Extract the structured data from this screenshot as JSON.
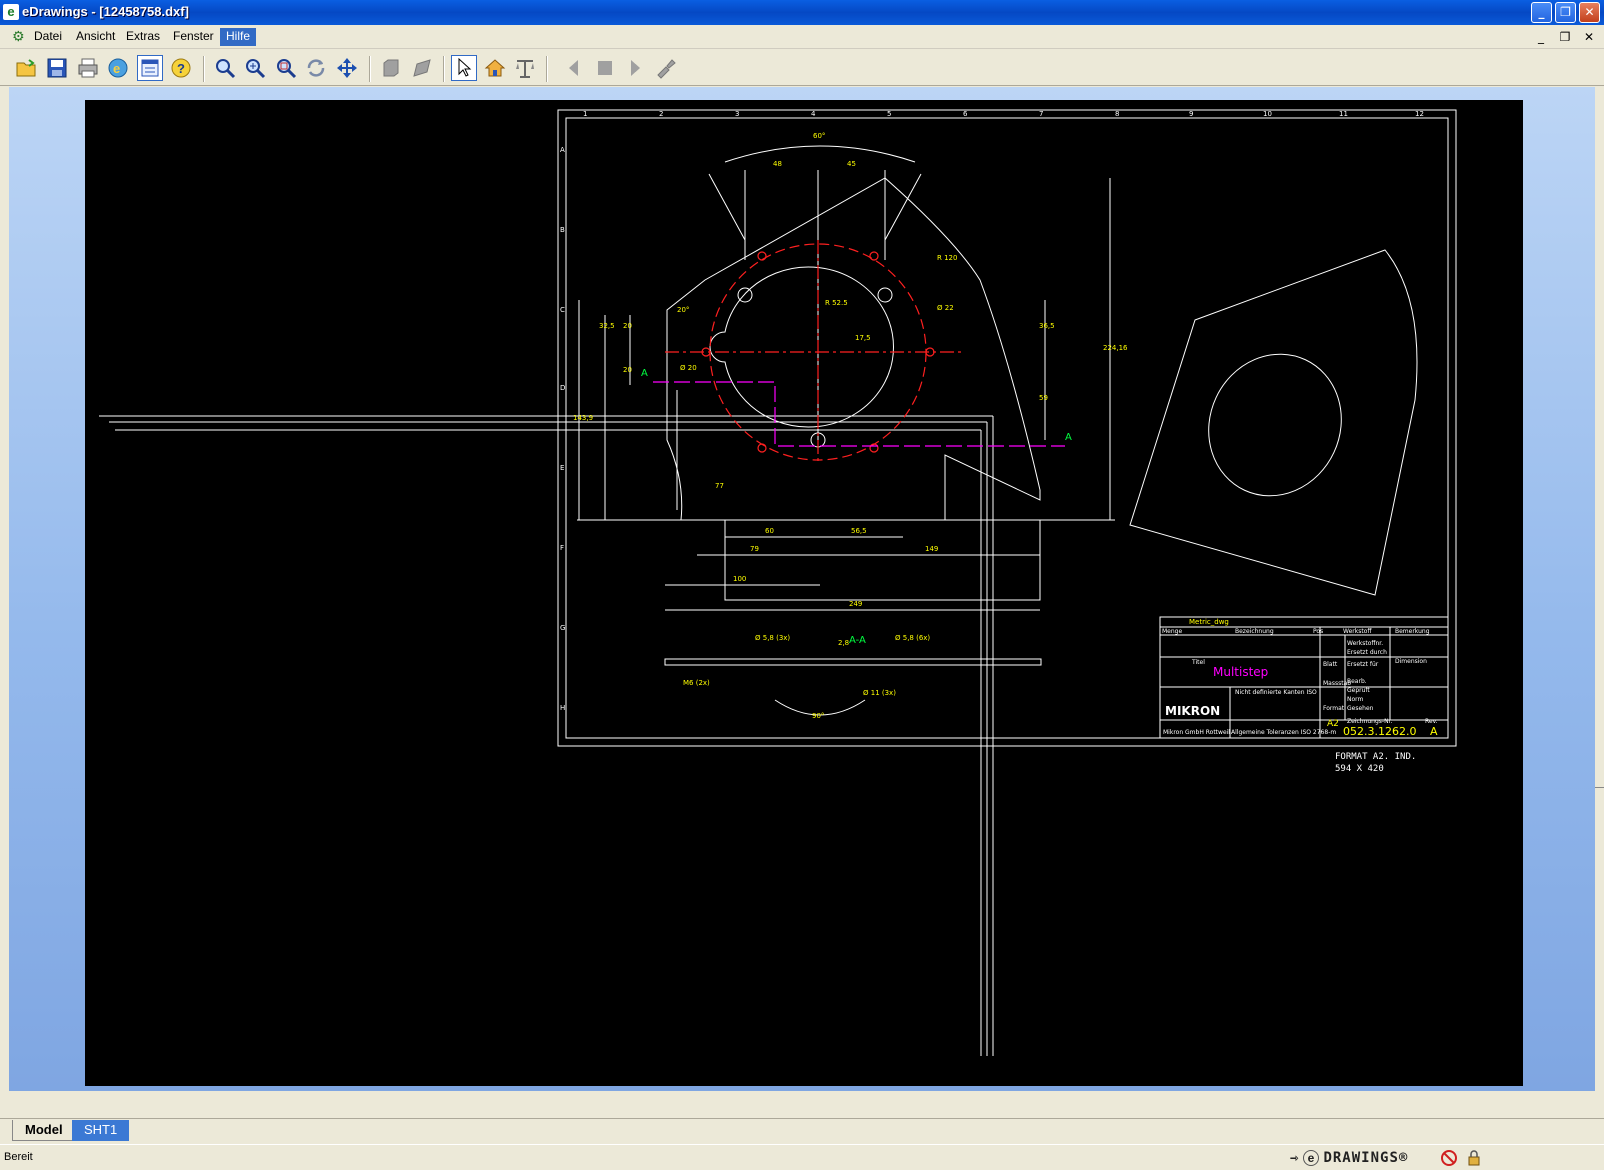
{
  "window": {
    "title": "eDrawings - [12458758.dxf]"
  },
  "menu": {
    "items": [
      "Datei",
      "Ansicht",
      "Extras",
      "Fenster",
      "Hilfe"
    ],
    "active": "Hilfe"
  },
  "toolbar": {
    "buttons": [
      "open-icon",
      "save-icon",
      "print-icon",
      "send-email-icon",
      "sheet-window-icon",
      "help-icon",
      "zoom-to-fit-icon",
      "zoom-in-out-icon",
      "zoom-to-area-icon",
      "rotate-icon",
      "pan-icon",
      "shaded-icon",
      "perspective-icon",
      "select-icon",
      "home-icon",
      "measure-icon",
      "previous-icon",
      "stop-icon",
      "play-icon",
      "markup-icon"
    ]
  },
  "drawing": {
    "frame_cols": [
      "1",
      "2",
      "3",
      "4",
      "5",
      "6",
      "7",
      "8",
      "9",
      "10",
      "11",
      "12"
    ],
    "frame_rows": [
      "A",
      "B",
      "C",
      "D",
      "E",
      "F",
      "G",
      "H"
    ],
    "dimensions": {
      "angle_top": "60°",
      "d48": "48",
      "d45": "45",
      "r120": "R 120",
      "r52": "R 52.5",
      "d22": "Ø 22",
      "d20a": "20",
      "d20b": "20",
      "d32": "32,5",
      "d36": "36,5",
      "d59": "59",
      "d17": "17,5",
      "d224": "224,16",
      "d143": "143,9",
      "d60": "60",
      "d56": "56,5",
      "d79": "79",
      "d149": "149",
      "d100": "100",
      "d249": "249",
      "ang77": "77",
      "ang20": "20°",
      "phi20": "Ø 20",
      "sect_a": "A",
      "section_label": "A-A",
      "hole1": "Ø 5,8 (3x)",
      "hole2": "Ø 5,8 (6x)",
      "m6": "M6 (2x)",
      "d11": "Ø 11 (3x)",
      "ang90": "90°",
      "d28": "2,8"
    },
    "title_block": {
      "file": "Metric_dwg",
      "hdr_menge": "Menge",
      "hdr_bez": "Bezeichnung",
      "hdr_pos": "Pos",
      "hdr_werkstoff": "Werkstoff",
      "hdr_bemerkung": "Bemerkung",
      "title_label": "Titel",
      "title": "Multistep",
      "company_logo": "MIKRON",
      "company": "Mikron GmbH Rottweil",
      "tolerance_note": "Nicht definierte Kanten ISO",
      "tolerance_general": "Allgemeine Toleranzen ISO 2768-m",
      "drawing_no_label": "Zeichnungs-Nr.",
      "drawing_no": "052.3.1262.0",
      "format": "A2",
      "rev_label": "Rev.",
      "rev": "A",
      "format_label": "Format",
      "masstab": "Massstab",
      "blatt": "Blatt",
      "ersetzt_durch": "Ersetzt durch",
      "ersetzt_fuer": "Ersetzt für",
      "dimension": "Dimension",
      "bearb": "Bearb.",
      "gepr": "Geprüft",
      "norm": "Norm",
      "gesehen": "Gesehen",
      "werkstoffnr": "Werkstoffnr."
    },
    "format_note_1": "FORMAT A2.  IND.",
    "format_note_2": "594 X 420"
  },
  "tabs": [
    "Model",
    "SHT1"
  ],
  "active_tab": "SHT1",
  "status": {
    "text": "Bereit",
    "brand": "DRAWINGS®"
  },
  "colors": {
    "accent": "#316ac5",
    "dim_yellow": "#ffff00",
    "center_red": "#ff2020",
    "section_magenta": "#ff00ff",
    "label_green": "#00ff40"
  }
}
